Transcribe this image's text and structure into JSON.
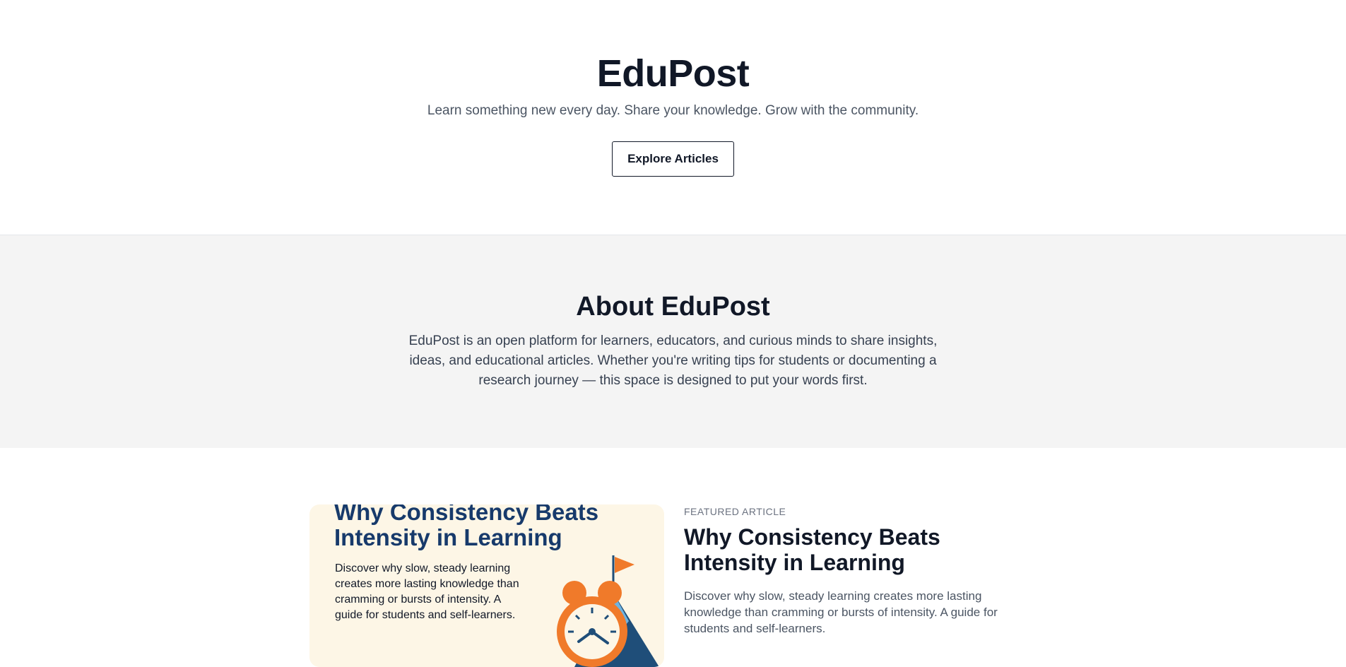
{
  "hero": {
    "title": "EduPost",
    "tagline": "Learn something new every day. Share your knowledge. Grow with the community.",
    "cta_label": "Explore Articles"
  },
  "about": {
    "title": "About EduPost",
    "text": "EduPost is an open platform for learners, educators, and curious minds to share insights, ideas, and educational articles. Whether you're writing tips for students or documenting a research journey — this space is designed to put your words first."
  },
  "featured": {
    "kicker": "Featured Article",
    "title": "Why Consistency Beats Intensity in Learning",
    "summary": "Discover why slow, steady learning creates more lasting knowledge than cramming or bursts of intensity. A guide for students and self-learners.",
    "image": {
      "title": "Why Consistency Beats Intensity in Learning",
      "description": "Discover why slow, steady learning creates more lasting knowledge than cramming or bursts of intensity. A guide for students and self-learners.",
      "icons": [
        "alarm-clock-icon",
        "mountain-flag-icon"
      ]
    }
  },
  "colors": {
    "heading": "#111827",
    "image_background": "#fdf6e6",
    "image_title": "#173a6b",
    "clock_orange": "#f07a2a",
    "mountain_blue": "#1f4e79"
  }
}
